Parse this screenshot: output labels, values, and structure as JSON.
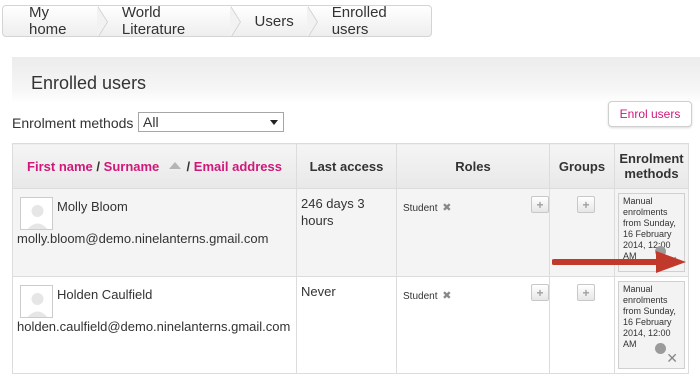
{
  "breadcrumb": {
    "items": [
      "My home",
      "World Literature",
      "Users",
      "Enrolled users"
    ]
  },
  "page": {
    "title": "Enrolled users",
    "enrol_button": "Enrol users"
  },
  "filter": {
    "label": "Enrolment methods",
    "selected": "All"
  },
  "table": {
    "headers": {
      "first_name": "First name",
      "surname": "Surname",
      "email": "Email address",
      "last_access": "Last access",
      "roles": "Roles",
      "groups": "Groups",
      "enrolment_methods": "Enrolment methods"
    },
    "sep": "/",
    "rows": [
      {
        "name": "Molly Bloom",
        "email": "molly.bloom@demo.ninelanterns.gmail.com",
        "last_access": "246 days 3 hours",
        "role": "Student",
        "method": "Manual enrolments from Sunday, 16 February 2014, 12:00 AM"
      },
      {
        "name": "Holden Caulfield",
        "email": "holden.caulfield@demo.ninelanterns.gmail.com",
        "last_access": "Never",
        "role": "Student",
        "method": "Manual enrolments from Sunday, 16 February 2014, 12:00 AM"
      }
    ]
  },
  "colors": {
    "accent": "#d0187a",
    "arrow": "#c0392b"
  },
  "icons": {
    "sort": "sort-ascending-icon",
    "remove": "close-icon",
    "add": "plus-icon",
    "edit": "gear-icon"
  }
}
